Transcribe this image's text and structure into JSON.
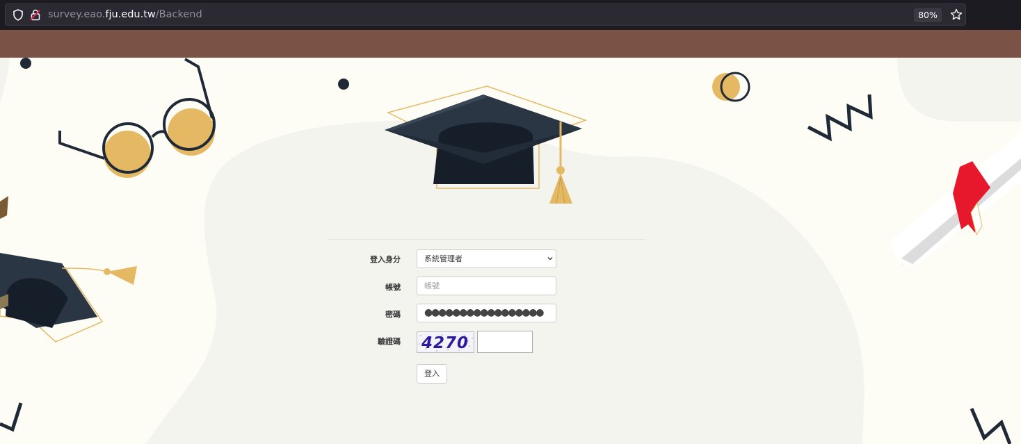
{
  "browser": {
    "url_prefix": "survey.eao.",
    "url_host": "fju.edu.tw",
    "url_path": "/Backend",
    "zoom": "80%"
  },
  "form": {
    "identity_label": "登入身分",
    "identity_value": "系統管理者",
    "account_label": "帳號",
    "account_placeholder": "帳號",
    "password_label": "密碼",
    "password_dots": "●●●●●●●●●●●●●●●●●",
    "captcha_label": "驗證碼",
    "captcha_code": "4270",
    "login_button": "登入"
  },
  "colors": {
    "header_bar": "#7a5346",
    "background": "#fdfdf6",
    "accent_gold": "#e5b964",
    "cap_dark": "#1c2530",
    "ribbon_red": "#e8182c"
  }
}
